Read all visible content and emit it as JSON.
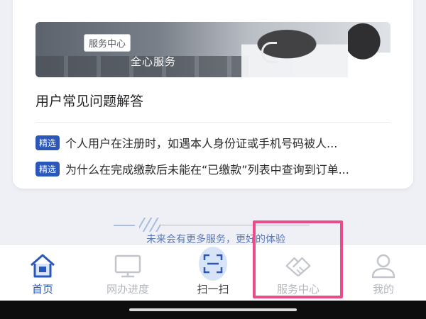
{
  "banner": {
    "tag": "服务中心",
    "subtitle": "全心服务"
  },
  "faq": {
    "title": "用户常见问题解答",
    "items": [
      {
        "badge": "精选",
        "question": "个人用户在注册时，如遇本人身份证或手机号码被人..."
      },
      {
        "badge": "精选",
        "question": "为什么在完成缴款后未能在“已缴款”列表中查询到订单..."
      }
    ]
  },
  "footer_hint": "未来会有更多服务，更好的体验",
  "tabs": [
    {
      "label": "首页",
      "icon": "home-icon",
      "active": true
    },
    {
      "label": "网办进度",
      "icon": "monitor-icon",
      "active": false
    },
    {
      "label": "扫一扫",
      "icon": "scan-icon",
      "active": false
    },
    {
      "label": "服务中心",
      "icon": "handshake-icon",
      "active": false
    },
    {
      "label": "我的",
      "icon": "user-icon",
      "active": false
    }
  ],
  "colors": {
    "accent": "#2b57b8",
    "highlight": "#e94b8b",
    "inactive": "#b4b7bd"
  }
}
